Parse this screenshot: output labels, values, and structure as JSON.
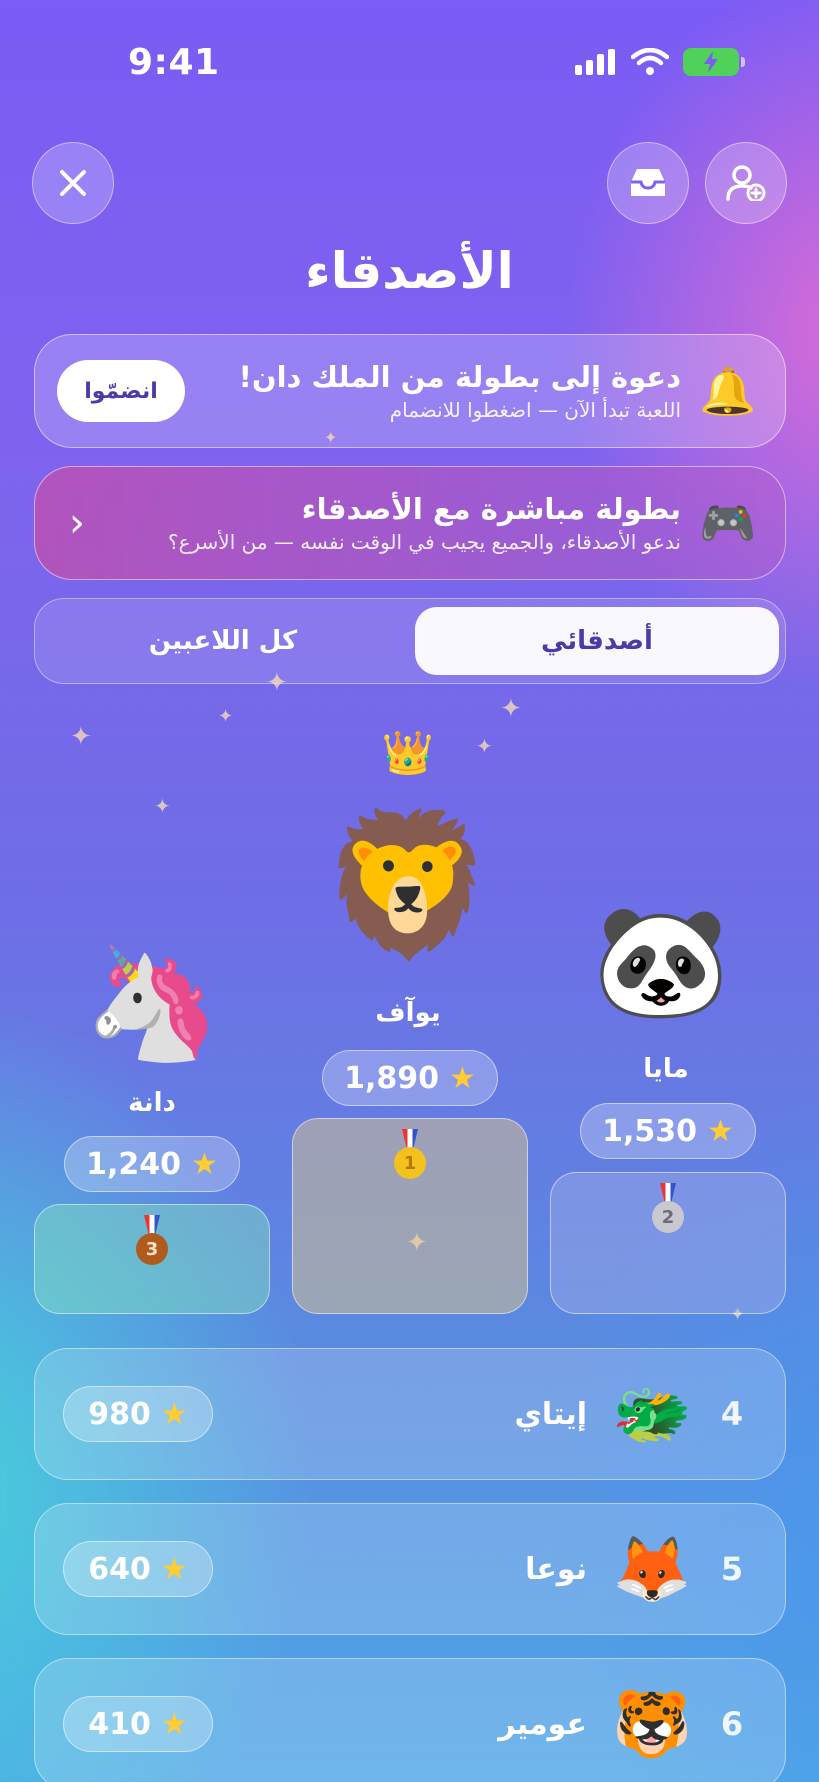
{
  "status": {
    "time": "9:41"
  },
  "header": {
    "title": "الأصدقاء",
    "close_icon": "close-icon",
    "inbox_icon": "inbox-icon",
    "add_friend_icon": "add-friend-icon"
  },
  "invite_banner": {
    "icon": "🔔",
    "title": "دعوة إلى بطولة من الملك دان!",
    "subtitle": "اللعبة تبدأ الآن — اضغطوا للانضمام",
    "button": "انضمّوا"
  },
  "live_banner": {
    "icon": "🎮",
    "title": "بطولة مباشرة مع الأصدقاء",
    "subtitle": "ندعو الأصدقاء، والجميع يجيب في الوقت نفسه — من الأسرع؟",
    "chevron": "‹"
  },
  "tabs": {
    "active": "أصدقائي",
    "inactive": "كل اللاعبين"
  },
  "podium": {
    "crown": "👑",
    "first": {
      "name": "يوآف",
      "score": "1,890",
      "avatar": "🦁",
      "medal": "1"
    },
    "second": {
      "name": "مايا",
      "score": "1,530",
      "avatar": "🐼",
      "medal": "2"
    },
    "third": {
      "name": "دانة",
      "score": "1,240",
      "avatar": "🦄",
      "medal": "3"
    }
  },
  "list": [
    {
      "rank": "4",
      "name": "إيتاي",
      "score": "980",
      "avatar": "🐲"
    },
    {
      "rank": "5",
      "name": "نوعا",
      "score": "640",
      "avatar": "🦊"
    },
    {
      "rank": "6",
      "name": "عومير",
      "score": "410",
      "avatar": "🐯"
    }
  ],
  "star_glyph": "★",
  "colors": {
    "accent": "#4b3aa8",
    "star": "#ffcc33",
    "battery": "#4fd15a"
  }
}
